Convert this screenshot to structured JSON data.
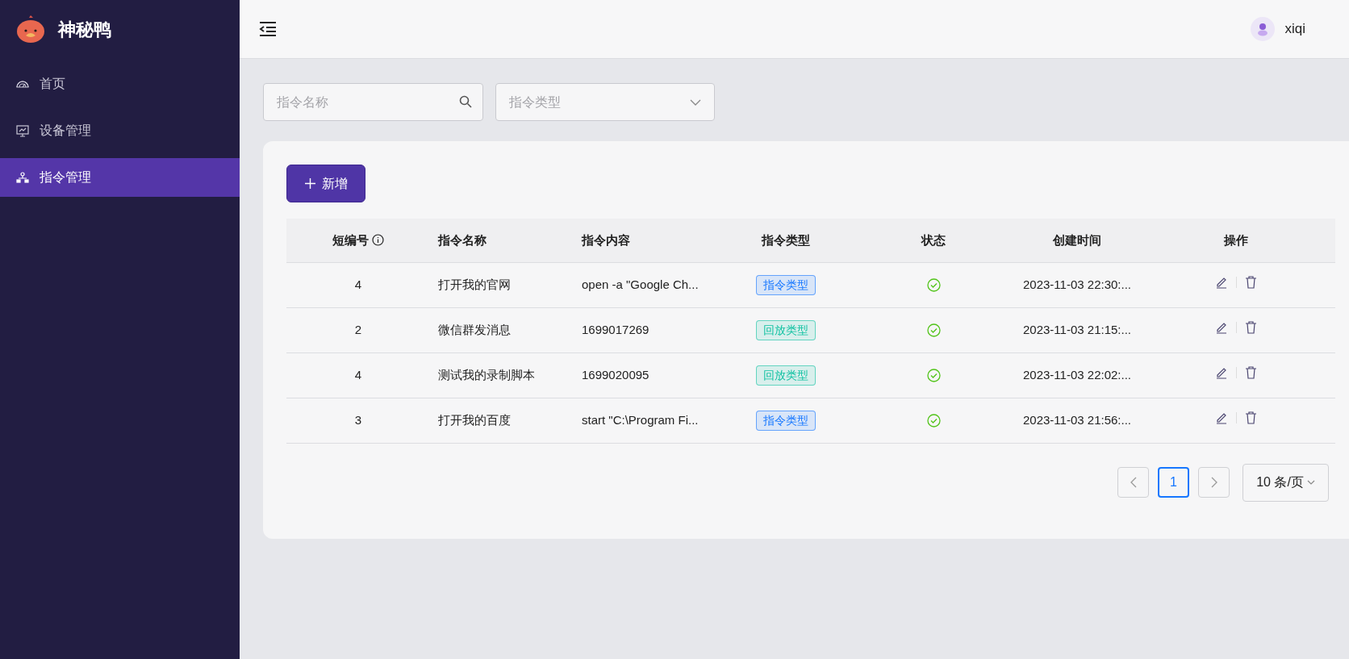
{
  "app": {
    "title": "神秘鸭"
  },
  "sidebar": {
    "items": [
      {
        "label": "首页",
        "selected": false
      },
      {
        "label": "设备管理",
        "selected": false
      },
      {
        "label": "指令管理",
        "selected": true
      }
    ]
  },
  "header": {
    "user": "xiqi"
  },
  "filters": {
    "name_placeholder": "指令名称",
    "type_placeholder": "指令类型"
  },
  "add_button": "新增",
  "table": {
    "columns": [
      "短编号",
      "指令名称",
      "指令内容",
      "指令类型",
      "状态",
      "创建时间",
      "操作"
    ],
    "rows": [
      {
        "id": "4",
        "name": "打开我的官网",
        "content": "open -a \"Google Ch...",
        "type": {
          "label": "指令类型",
          "color": "#1677ff"
        },
        "enabled": true,
        "created": "2023-11-03 22:30:..."
      },
      {
        "id": "2",
        "name": "微信群发消息",
        "content": "1699017269",
        "type": {
          "label": "回放类型",
          "color": "#13c2a3"
        },
        "enabled": true,
        "created": "2023-11-03 21:15:..."
      },
      {
        "id": "4",
        "name": "测试我的录制脚本",
        "content": "1699020095",
        "type": {
          "label": "回放类型",
          "color": "#13c2a3"
        },
        "enabled": true,
        "created": "2023-11-03 22:02:..."
      },
      {
        "id": "3",
        "name": "打开我的百度",
        "content": "start \"C:\\Program Fi...",
        "type": {
          "label": "指令类型",
          "color": "#1677ff"
        },
        "enabled": true,
        "created": "2023-11-03 21:56:..."
      }
    ]
  },
  "pagination": {
    "pages": [
      {
        "label": "1",
        "selected": true
      }
    ],
    "page_size": "10 条/页"
  }
}
